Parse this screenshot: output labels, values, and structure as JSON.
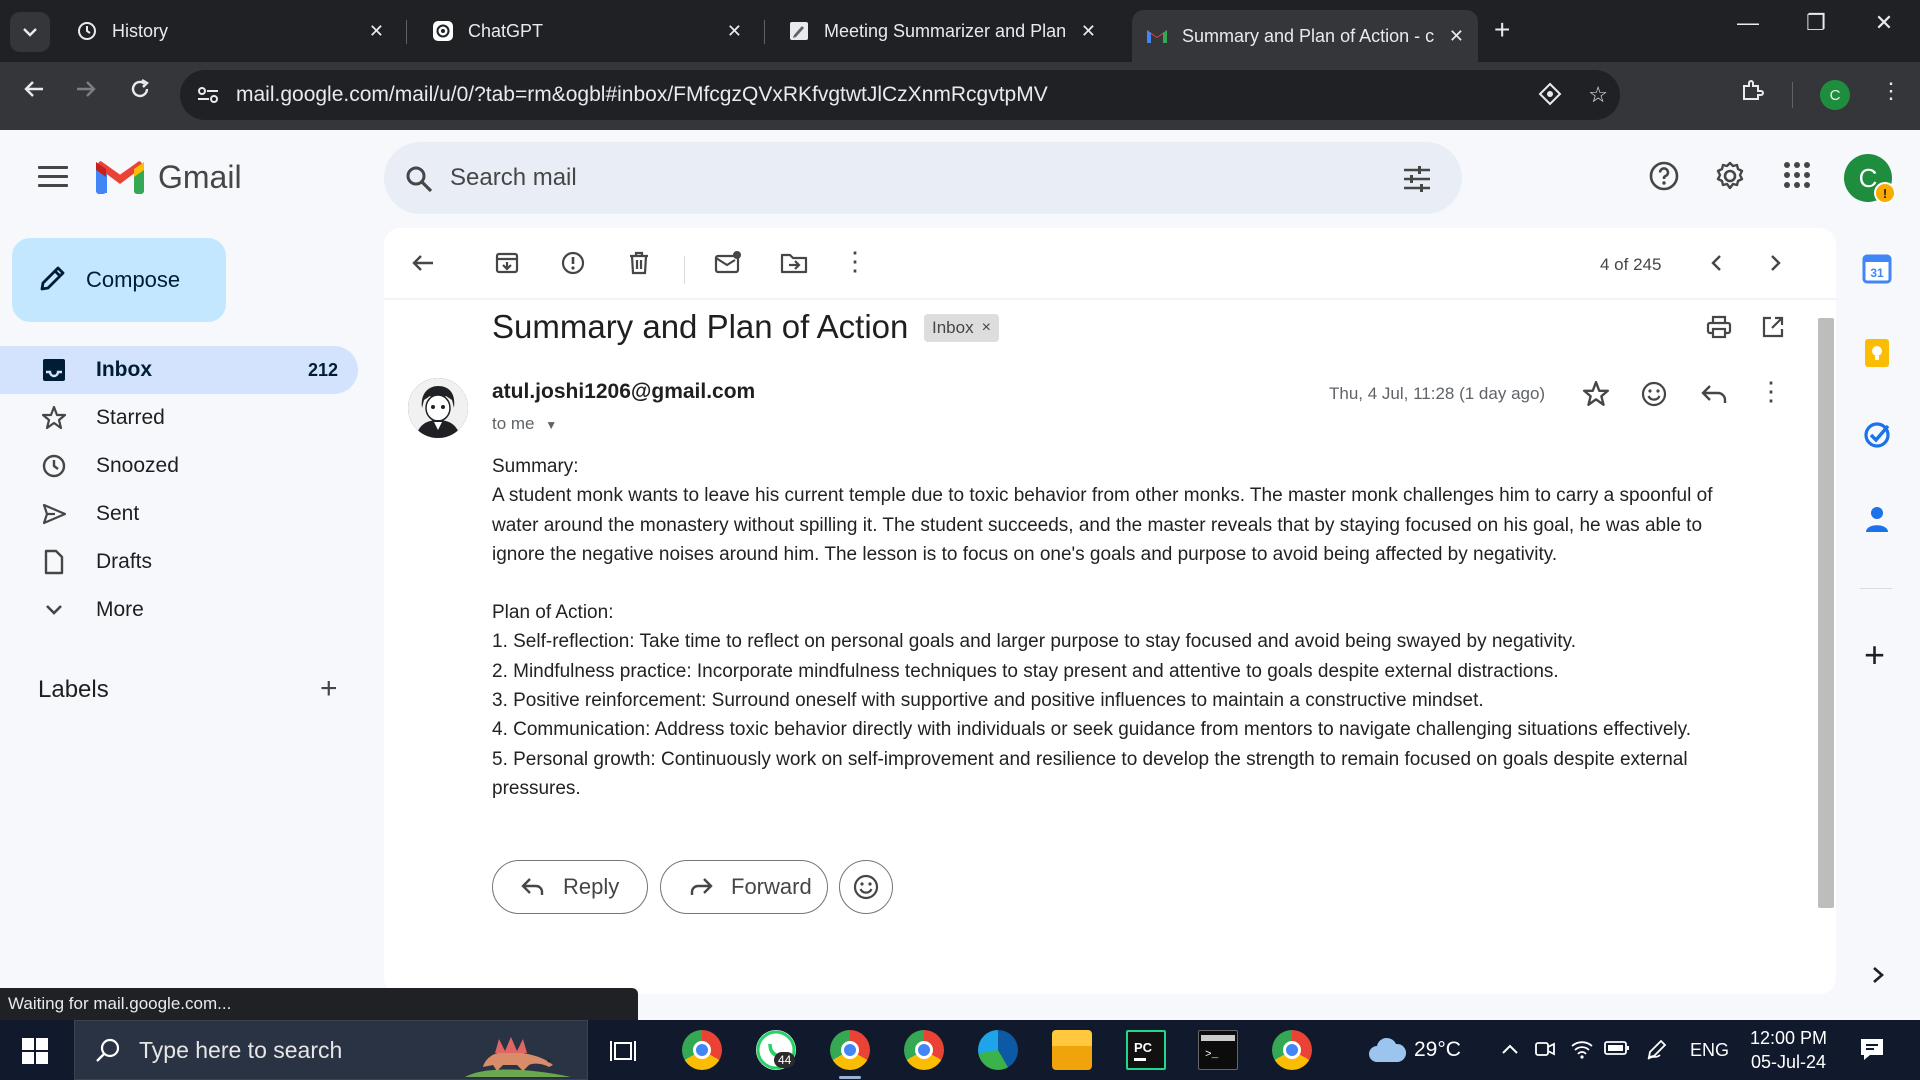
{
  "browser": {
    "tabs": [
      {
        "label": "History",
        "icon": "history-icon"
      },
      {
        "label": "ChatGPT",
        "icon": "chatgpt-icon"
      },
      {
        "label": "Meeting Summarizer and Plan c",
        "icon": "document-icon"
      },
      {
        "label": "Summary and Plan of Action - c",
        "icon": "gmail-icon"
      }
    ],
    "url": "mail.google.com/mail/u/0/?tab=rm&ogbl#inbox/FMfcgzQVxRKfvgtwtJlCzXnmRcgvtpMV",
    "profile_initial": "C"
  },
  "gmail": {
    "app_name": "Gmail",
    "search_placeholder": "Search mail",
    "avatar_initial": "C",
    "avatar_badge": "!",
    "compose_label": "Compose",
    "nav": [
      {
        "label": "Inbox",
        "count": "212",
        "icon": "inbox-icon"
      },
      {
        "label": "Starred",
        "count": "",
        "icon": "star-icon"
      },
      {
        "label": "Snoozed",
        "count": "",
        "icon": "clock-icon"
      },
      {
        "label": "Sent",
        "count": "",
        "icon": "send-icon"
      },
      {
        "label": "Drafts",
        "count": "",
        "icon": "draft-icon"
      },
      {
        "label": "More",
        "count": "",
        "icon": "chevron-down-icon"
      }
    ],
    "labels_heading": "Labels"
  },
  "message": {
    "pager": "4 of 245",
    "subject": "Summary and Plan of Action",
    "label_chip": "Inbox",
    "chip_close": "×",
    "sender": "atul.joshi1206@gmail.com",
    "to": "to me",
    "date": "Thu, 4 Jul, 11:28 (1 day ago)",
    "body": {
      "summary_heading": "Summary:",
      "summary_lines": [
        "A student monk wants to leave his current temple due to toxic behavior from other monks. The master monk challenges him to carry a spoonful of",
        "water around the monastery without spilling it. The student succeeds, and the master reveals that by staying focused on his goal, he was able to",
        "ignore the negative noises around him. The lesson is to focus on one's goals and purpose to avoid being affected by negativity."
      ],
      "plan_heading": "Plan of Action:",
      "plan_lines": [
        "1. Self-reflection: Take time to reflect on personal goals and larger purpose to stay focused and avoid being swayed by negativity.",
        "2. Mindfulness practice: Incorporate mindfulness techniques to stay present and attentive to goals despite external distractions.",
        "3. Positive reinforcement: Surround oneself with supportive and positive influences to maintain a constructive mindset.",
        "4. Communication: Address toxic behavior directly with individuals or seek guidance from mentors to navigate challenging situations effectively.",
        "5. Personal growth: Continuously work on self-improvement and resilience to develop the strength to remain focused on goals despite external",
        "pressures."
      ]
    },
    "reply_label": "Reply",
    "forward_label": "Forward"
  },
  "status_text": "Waiting for mail.google.com...",
  "taskbar": {
    "search_placeholder": "Type here to search",
    "weather": "29°C",
    "language": "ENG",
    "time": "12:00 PM",
    "date": "05-Jul-24",
    "whatsapp_badge": "44"
  },
  "colors": {
    "accent": "#0b57d0",
    "selected_nav": "#d3e3fd",
    "compose": "#c2e7ff",
    "chrome_dark": "#202124"
  }
}
